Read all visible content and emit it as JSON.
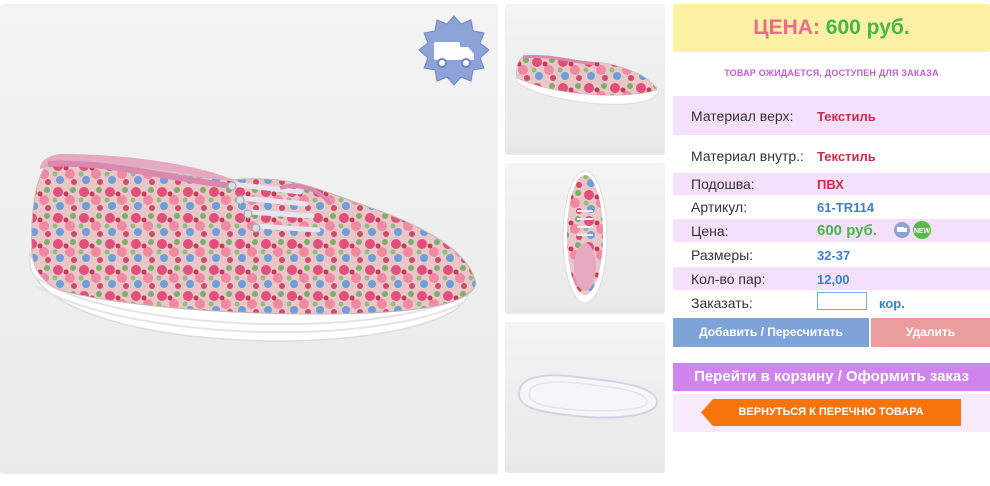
{
  "images": {
    "main_alt": "shoe-main",
    "thumbs": [
      "shoe-side",
      "shoe-top",
      "shoe-sole"
    ]
  },
  "price_box": {
    "label": "ЦЕНА:",
    "value": "600 руб."
  },
  "status": "ТОВАР ОЖИДАЕТСЯ, ДОСТУПЕН ДЛЯ ЗАКАЗА",
  "specs": [
    {
      "key": "Материал верх:",
      "value": "Текстиль"
    },
    {
      "key": "Материал внутр.:",
      "value": "Текстиль"
    },
    {
      "key": "Подошва:",
      "value": "ПВХ"
    },
    {
      "key": "Артикул:",
      "value": "61-TR114"
    },
    {
      "key": "Цена:",
      "value": "600 руб."
    },
    {
      "key": "Размеры:",
      "value": "32-37"
    },
    {
      "key": "Кол-во пар:",
      "value": "12,00"
    },
    {
      "key": "Заказать:",
      "value": "кор."
    }
  ],
  "order_input": {
    "value": "",
    "placeholder": ""
  },
  "buttons": {
    "add": "Добавить / Пересчитать",
    "delete": "Удалить",
    "cart": "Перейти в корзину / Оформить заказ",
    "back": "ВЕРНУТЬСЯ К ПЕРЕЧНЮ ТОВАРА"
  },
  "icons": {
    "delivery_badge": "truck-icon",
    "mini_truck": "truck-icon",
    "new_badge": "new-icon",
    "new_badge_text": "NEW"
  },
  "colors": {
    "price_bg": "#fbf0a3",
    "price_label": "#ee6a8a",
    "price_value": "#46b749",
    "row_highlight": "#f4e0fb",
    "add_button": "#7ea3d9",
    "delete_button": "#eb9c9c",
    "cart_button": "#d084ee",
    "back_button": "#f7740c"
  }
}
